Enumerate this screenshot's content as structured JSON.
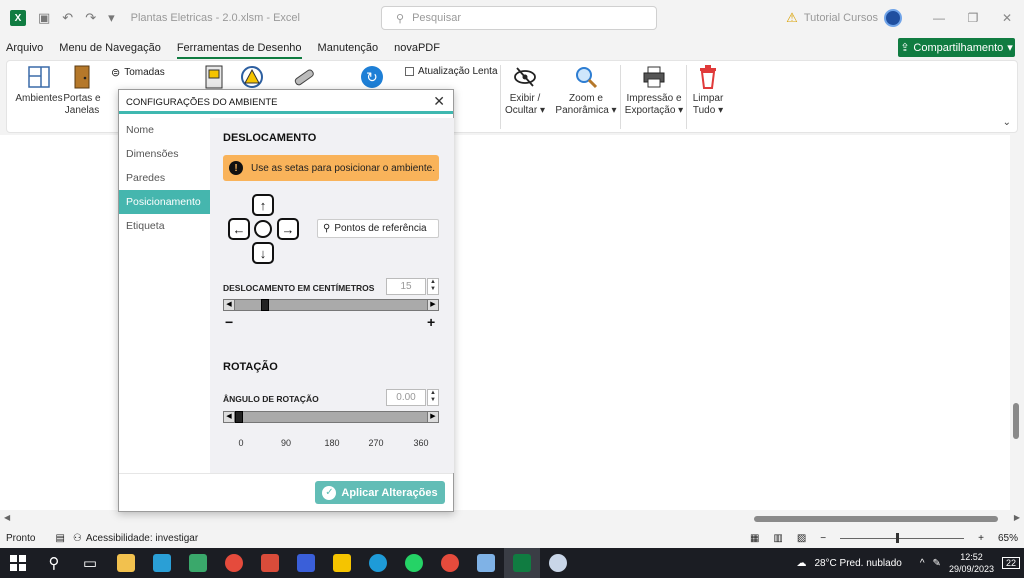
{
  "titlebar": {
    "doc_title": "Plantas Eletricas - 2.0.xlsm  -  Excel",
    "search_placeholder": "Pesquisar",
    "user": "Tutorial Cursos"
  },
  "menu": {
    "items": [
      "Arquivo",
      "Menu de Navegação",
      "Ferramentas de Desenho",
      "Manutenção",
      "novaPDF"
    ],
    "active": "Ferramentas de Desenho",
    "share": "Compartilhamento"
  },
  "ribbon": {
    "ambientes": "Ambientes",
    "portas": "Portas e",
    "janelas": "Janelas",
    "tomadas": "Tomadas",
    "atualizacao": "Atualização Lenta",
    "exibir": "Exibir /",
    "ocultar": "Ocultar",
    "zoom": "Zoom e",
    "panoramica": "Panorâmica",
    "impressao": "Impressão e",
    "exportacao": "Exportação",
    "limpar": "Limpar",
    "tudo": "Tudo"
  },
  "dialog": {
    "title": "CONFIGURAÇÕES DO AMBIENTE",
    "nav": [
      "Nome",
      "Dimensões",
      "Paredes",
      "Posicionamento",
      "Etiqueta"
    ],
    "active_nav": "Posicionamento",
    "deslocamento_title": "DESLOCAMENTO",
    "hint": "Use as setas para posicionar o ambiente.",
    "ref_button": "Pontos de referência",
    "offset_label": "DESLOCAMENTO EM CENTÍMETROS",
    "offset_value": "15",
    "minus": "−",
    "plus": "+",
    "rotacao_title": "ROTAÇÃO",
    "angle_label": "ÂNGULO DE ROTAÇÃO",
    "angle_value": "0.00",
    "ticks": [
      "0",
      "90",
      "180",
      "270",
      "360"
    ],
    "apply": "Aplicar Alterações"
  },
  "statusbar": {
    "ready": "Pronto",
    "accessibility": "Acessibilidade: investigar",
    "zoom": "65%"
  },
  "taskbar": {
    "weather": "28°C  Pred. nublado",
    "time": "12:52",
    "date": "29/09/2023",
    "notif": "22"
  }
}
